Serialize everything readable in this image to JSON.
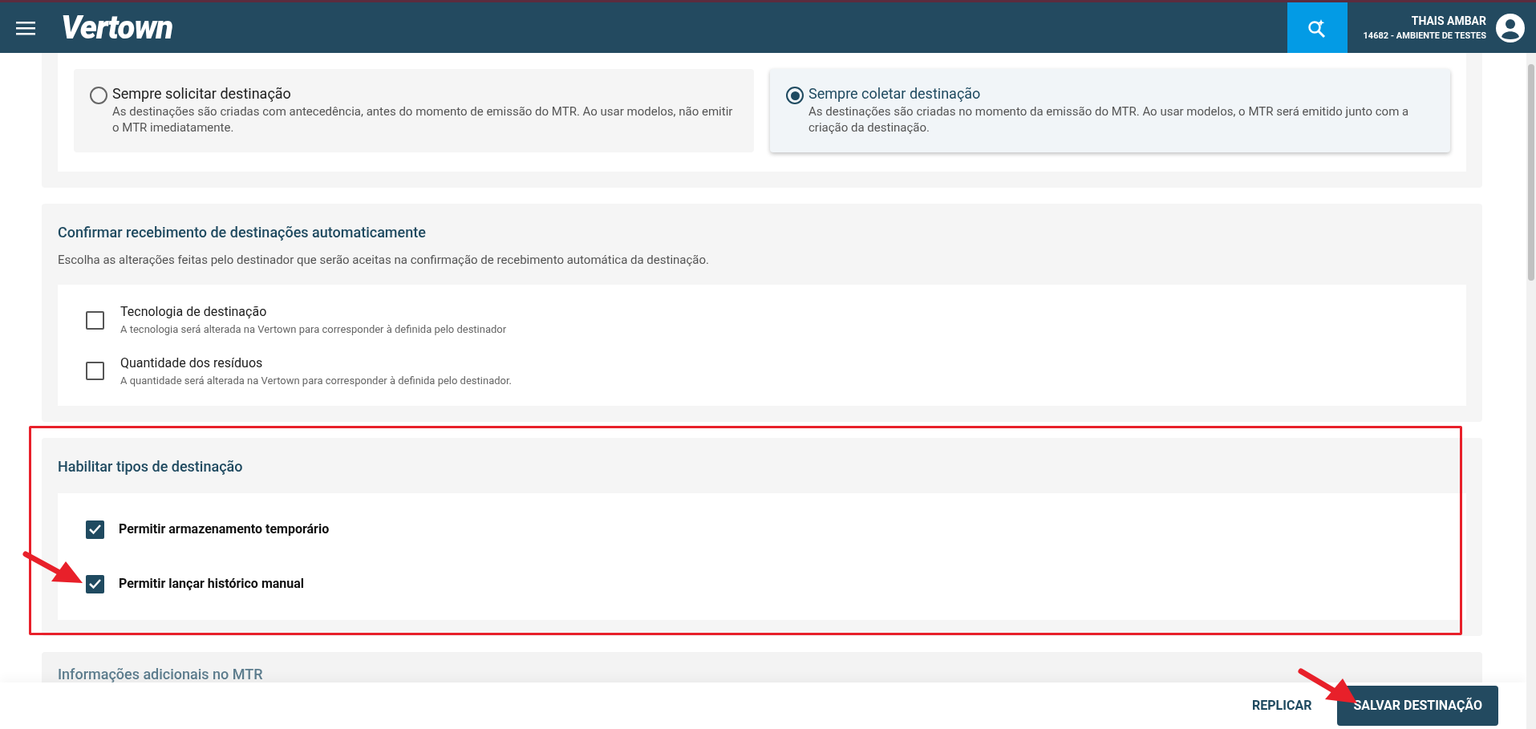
{
  "header": {
    "logo": "Vertown",
    "user_name": "THAIS AMBAR",
    "user_env": "14682 - AMBIENTE DE TESTES"
  },
  "destination_mode": {
    "options": [
      {
        "title": "Sempre solicitar destinação",
        "description": "As destinações são criadas com antecedência, antes do momento de emissão do MTR. Ao usar modelos, não emitir o MTR imediatamente.",
        "selected": false
      },
      {
        "title": "Sempre coletar destinação",
        "description": "As destinações são criadas no momento da emissão do MTR. Ao usar modelos, o MTR será emitido junto com a criação da destinação.",
        "selected": true
      }
    ]
  },
  "auto_confirm": {
    "title": "Confirmar recebimento de destinações automaticamente",
    "subtitle": "Escolha as alterações feitas pelo destinador que serão aceitas na confirmação de recebimento automática da destinação.",
    "items": [
      {
        "label": "Tecnologia de destinação",
        "description": "A tecnologia será alterada na Vertown para corresponder à definida pelo destinador",
        "checked": false
      },
      {
        "label": "Quantidade dos resíduos",
        "description": "A quantidade será alterada na Vertown para corresponder à definida pelo destinador.",
        "checked": false
      }
    ]
  },
  "destination_types": {
    "title": "Habilitar tipos de destinação",
    "items": [
      {
        "label": "Permitir armazenamento temporário",
        "checked": true
      },
      {
        "label": "Permitir lançar histórico manual",
        "checked": true
      }
    ]
  },
  "next_section": {
    "title": "Informações adicionais no MTR"
  },
  "footer": {
    "buttons": [
      {
        "label": "REPLICAR",
        "kind": "text"
      },
      {
        "label": "SALVAR DESTINAÇÃO",
        "kind": "primary"
      }
    ]
  }
}
